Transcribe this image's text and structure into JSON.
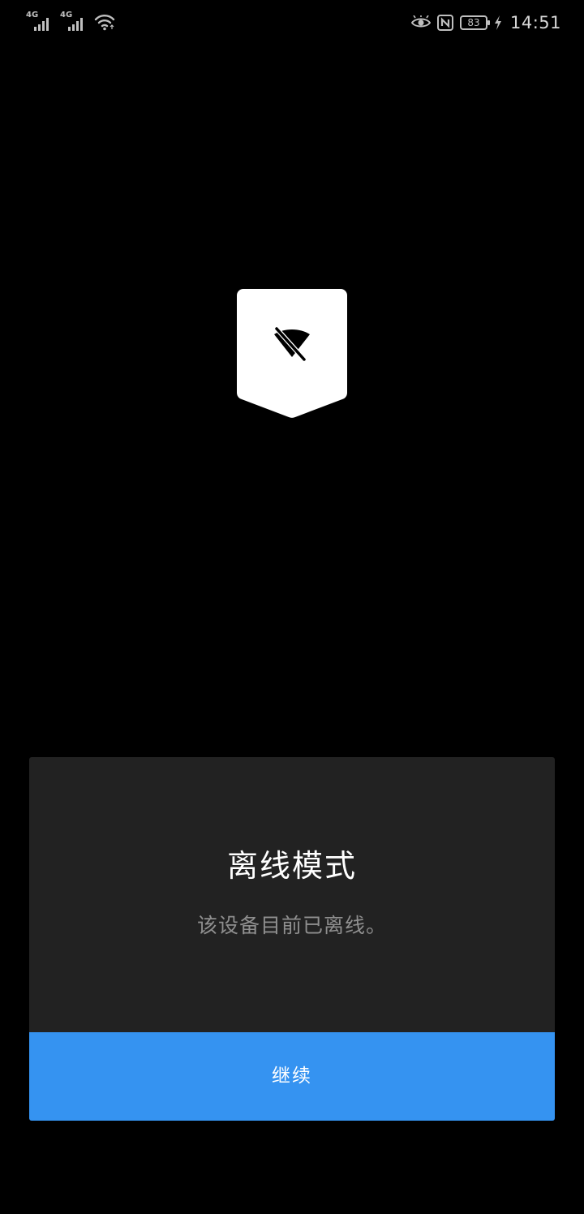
{
  "status_bar": {
    "sim1_network": "4G",
    "sim2_network": "4G",
    "battery_level": "83",
    "time": "14:51",
    "icons": [
      "signal-icon",
      "wifi-icon",
      "eye-comfort-icon",
      "nfc-icon",
      "battery-icon",
      "charging-icon"
    ]
  },
  "badge": {
    "icon": "wifi-off-icon",
    "background_color": "#ffffff"
  },
  "dialog": {
    "title": "离线模式",
    "message": "该设备目前已离线。",
    "continue_label": "继续",
    "background_color": "#222222",
    "button_color": "#3593f1"
  }
}
